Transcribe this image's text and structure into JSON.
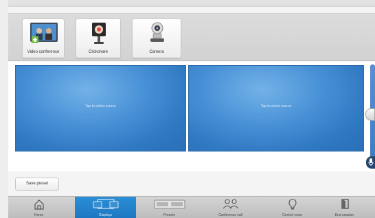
{
  "sources": {
    "items": [
      {
        "label": "Video conference",
        "icon": "video-conference-icon"
      },
      {
        "label": "Clickshare",
        "icon": "clickshare-icon"
      },
      {
        "label": "Camera",
        "icon": "camera-icon"
      }
    ]
  },
  "displays": {
    "screens": [
      {
        "prompt": "Tap to select source"
      },
      {
        "prompt": "Tap to select source"
      }
    ]
  },
  "volume": {
    "icon": "volume-slider-icon"
  },
  "mic": {
    "icon": "microphone-icon"
  },
  "actions": {
    "save_preset_label": "Save preset"
  },
  "nav": {
    "active": "Displays",
    "items": [
      {
        "label": "Home",
        "icon": "home-icon"
      },
      {
        "label": "Displays",
        "icon": "displays-icon"
      },
      {
        "label": "Presets",
        "icon": "presets-icon"
      },
      {
        "label": "Conference call",
        "icon": "conference-call-icon"
      },
      {
        "label": "Control room",
        "icon": "control-room-icon"
      },
      {
        "label": "End session",
        "icon": "end-session-icon"
      }
    ]
  },
  "colors": {
    "accent": "#1d77c0",
    "screen": "#3a82c9",
    "mic": "#24466f"
  }
}
